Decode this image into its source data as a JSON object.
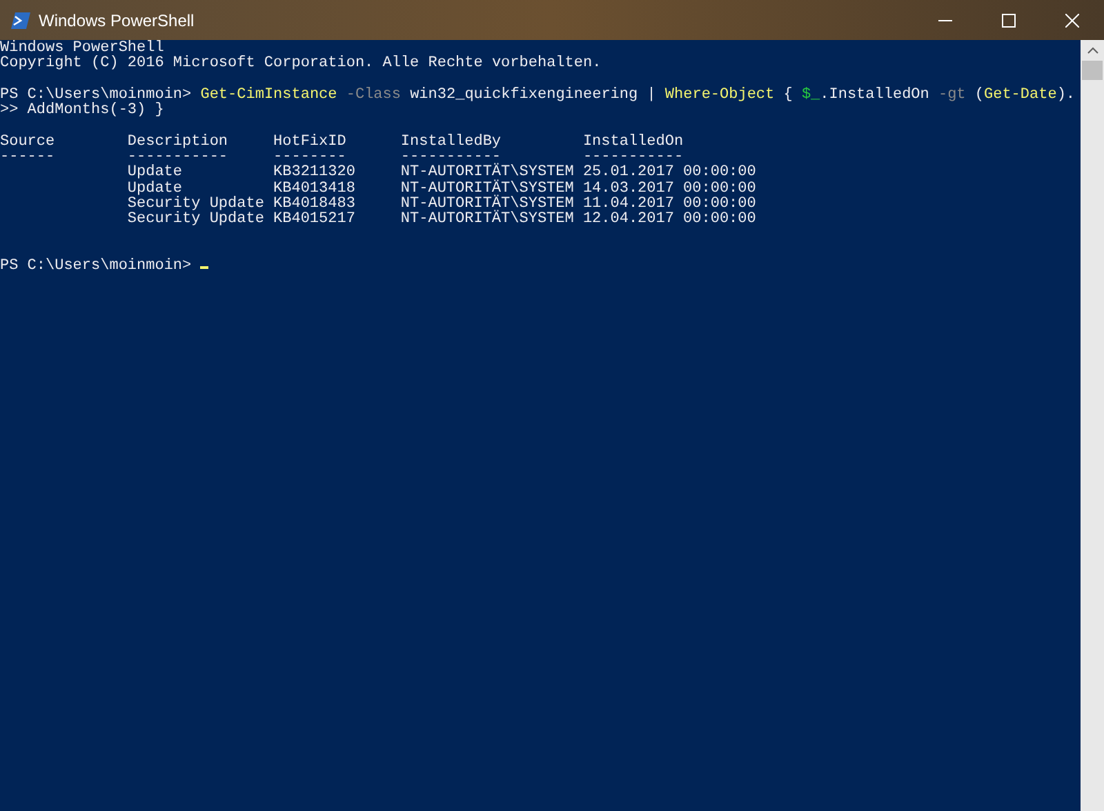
{
  "window": {
    "title": "Windows PowerShell"
  },
  "banner": [
    "Windows PowerShell",
    "Copyright (C) 2016 Microsoft Corporation. Alle Rechte vorbehalten."
  ],
  "command": {
    "prompt": "PS C:\\Users\\moinmoin> ",
    "segments": [
      {
        "kind": "command",
        "text": "Get-CimInstance"
      },
      {
        "kind": "parameter",
        "text": " -Class"
      },
      {
        "kind": "text",
        "text": " win32_quickfixengineering | "
      },
      {
        "kind": "command",
        "text": "Where-Object"
      },
      {
        "kind": "text",
        "text": " { "
      },
      {
        "kind": "variable",
        "text": "$_"
      },
      {
        "kind": "text",
        "text": ".InstalledOn "
      },
      {
        "kind": "parameter",
        "text": "-gt"
      },
      {
        "kind": "text",
        "text": " ("
      },
      {
        "kind": "command",
        "text": "Get-Date"
      },
      {
        "kind": "text",
        "text": ")."
      }
    ],
    "continuation": ">> AddMonths(-3) }"
  },
  "table": {
    "columns": [
      {
        "header": "Source",
        "rule": "------"
      },
      {
        "header": "Description",
        "rule": "-----------"
      },
      {
        "header": "HotFixID",
        "rule": "--------"
      },
      {
        "header": "InstalledBy",
        "rule": "-----------"
      },
      {
        "header": "InstalledOn",
        "rule": "-----------"
      }
    ],
    "rows": [
      [
        "",
        "Update",
        "KB3211320",
        "NT-AUTORITÄT\\SYSTEM",
        "25.01.2017 00:00:00"
      ],
      [
        "",
        "Update",
        "KB4013418",
        "NT-AUTORITÄT\\SYSTEM",
        "14.03.2017 00:00:00"
      ],
      [
        "",
        "Security Update",
        "KB4018483",
        "NT-AUTORITÄT\\SYSTEM",
        "11.04.2017 00:00:00"
      ],
      [
        "",
        "Security Update",
        "KB4015217",
        "NT-AUTORITÄT\\SYSTEM",
        "12.04.2017 00:00:00"
      ]
    ]
  },
  "final_prompt": "PS C:\\Users\\moinmoin> "
}
